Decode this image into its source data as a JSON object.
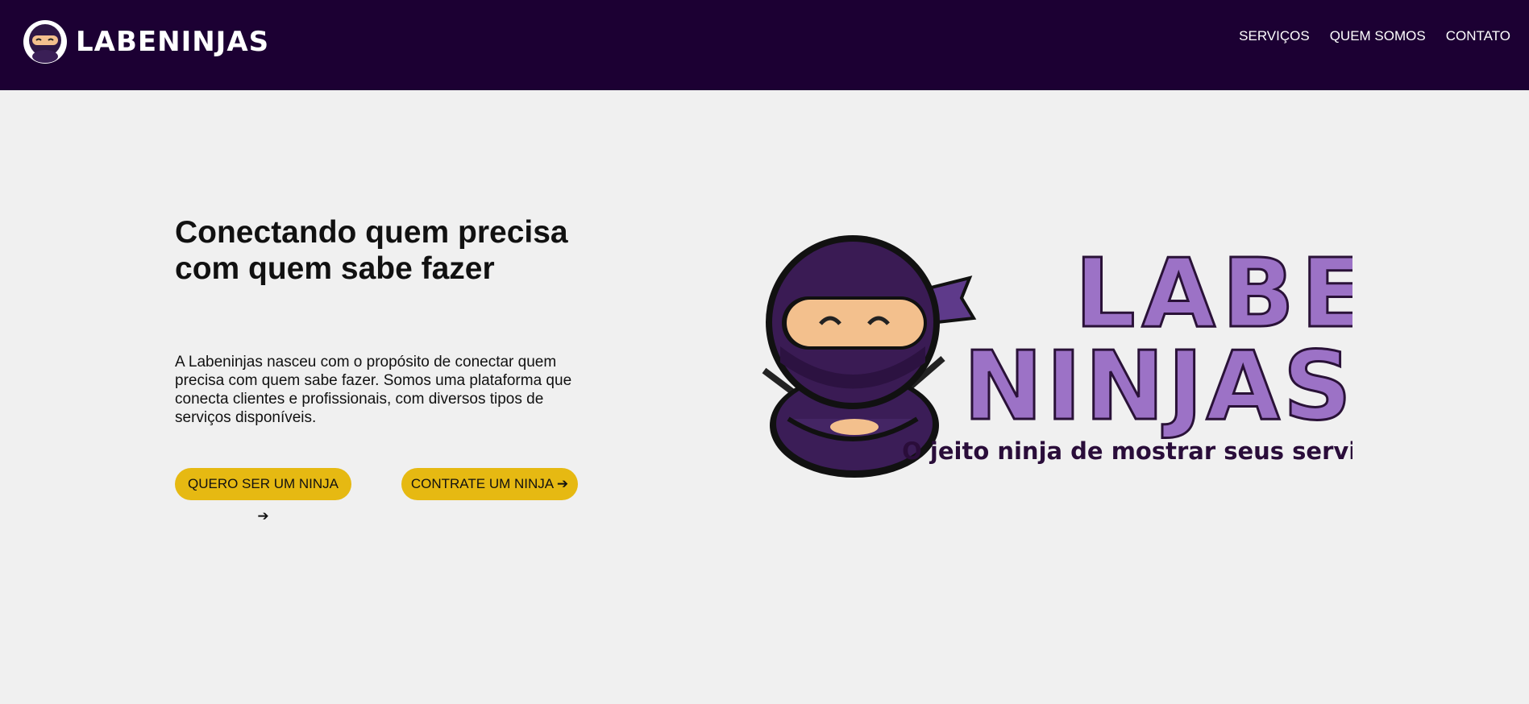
{
  "header": {
    "brand": "LABENINJAS",
    "nav": [
      "SERVIÇOS",
      "QUEM SOMOS",
      "CONTATO"
    ],
    "bg_color": "#1c0033"
  },
  "hero": {
    "title": "Conectando quem precisa com quem sabe fazer",
    "description": "A Labeninjas nasceu com o propósito de conectar quem precisa com quem sabe fazer. Somos uma plataforma que conecta clientes e profissionais, com diversos tipos de serviços disponíveis.",
    "buttons": [
      "QUERO SER UM NINJA ➔",
      "CONTRATE UM NINJA ➔"
    ],
    "button_color": "#e6b912"
  },
  "illustration": {
    "logo_line1": "LABE",
    "logo_line2": "NINJAS",
    "tagline": "O jeito ninja de mostrar seus serviços!",
    "icon": "ninja-mascot-icon"
  }
}
